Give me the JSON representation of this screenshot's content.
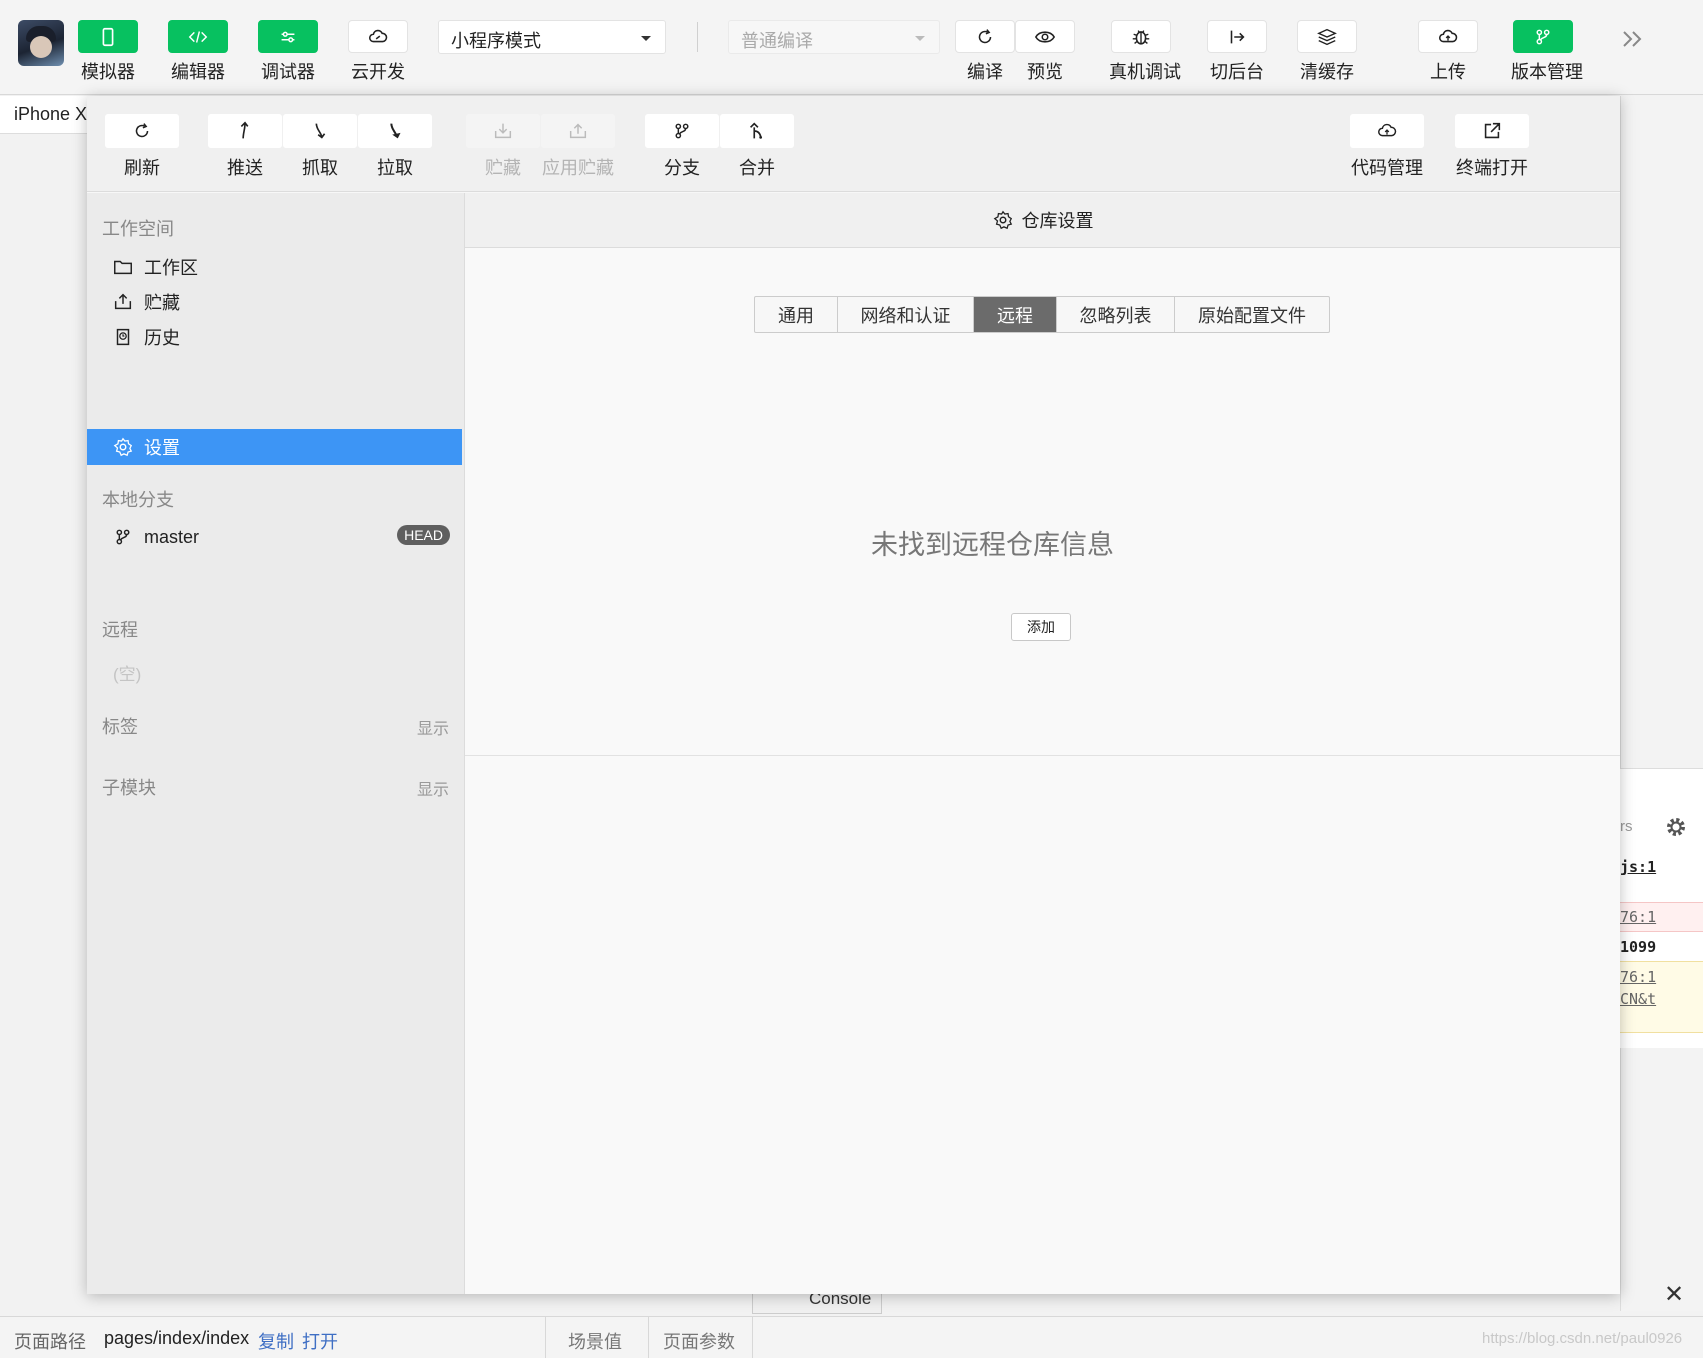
{
  "toolbar": {
    "left_buttons": [
      {
        "label": "模拟器",
        "icon": "phone-icon"
      },
      {
        "label": "编辑器",
        "icon": "code-icon"
      },
      {
        "label": "调试器",
        "icon": "sliders-icon"
      },
      {
        "label": "云开发",
        "icon": "cloud-link-icon"
      }
    ],
    "mode_select": "小程序模式",
    "compile_select": "普通编译",
    "right_buttons": [
      {
        "label": "编译",
        "icon": "refresh-icon"
      },
      {
        "label": "预览",
        "icon": "eye-icon"
      },
      {
        "label": "真机调试",
        "icon": "bug-icon"
      },
      {
        "label": "切后台",
        "icon": "switch-icon"
      },
      {
        "label": "清缓存",
        "icon": "layers-icon"
      },
      {
        "label": "上传",
        "icon": "cloud-upload-icon"
      },
      {
        "label": "版本管理",
        "icon": "git-icon"
      }
    ]
  },
  "simulator": {
    "device": "iPhone X"
  },
  "version_panel": {
    "tools": {
      "refresh": "刷新",
      "push": "推送",
      "fetch": "抓取",
      "pull": "拉取",
      "stash": "贮藏",
      "apply_stash": "应用贮藏",
      "branch": "分支",
      "merge": "合并",
      "code_manage": "代码管理",
      "terminal_open": "终端打开"
    },
    "sidebar": {
      "workspace_title": "工作空间",
      "workspace_items": [
        "工作区",
        "贮藏",
        "历史",
        "设置"
      ],
      "local_branch_title": "本地分支",
      "branch_name": "master",
      "branch_badge": "HEAD",
      "remote_title": "远程",
      "remote_empty": "(空)",
      "tags_title": "标签",
      "tags_action": "显示",
      "submodule_title": "子模块",
      "submodule_action": "显示"
    },
    "main": {
      "title": "仓库设置",
      "tabs": [
        "通用",
        "网络和认证",
        "远程",
        "忽略列表",
        "原始配置文件"
      ],
      "active_tab": "远程",
      "empty_message": "未找到远程仓库信息",
      "add_button": "添加"
    }
  },
  "devtools_fragments": {
    "f1": "rs",
    "f2": "js:1",
    "f3": "76:1",
    "f4": "1099",
    "f5": "76:1",
    "f6": "CN&t"
  },
  "console_tab": "Console",
  "statusbar": {
    "path_label": "页面路径",
    "path": "pages/index/index",
    "copy": "复制",
    "open": "打开",
    "scene": "场景值",
    "params": "页面参数"
  },
  "watermark": "https://blog.csdn.net/paul0926",
  "colors": {
    "accent_green": "#07c160",
    "selection_blue": "#3d95f5"
  }
}
